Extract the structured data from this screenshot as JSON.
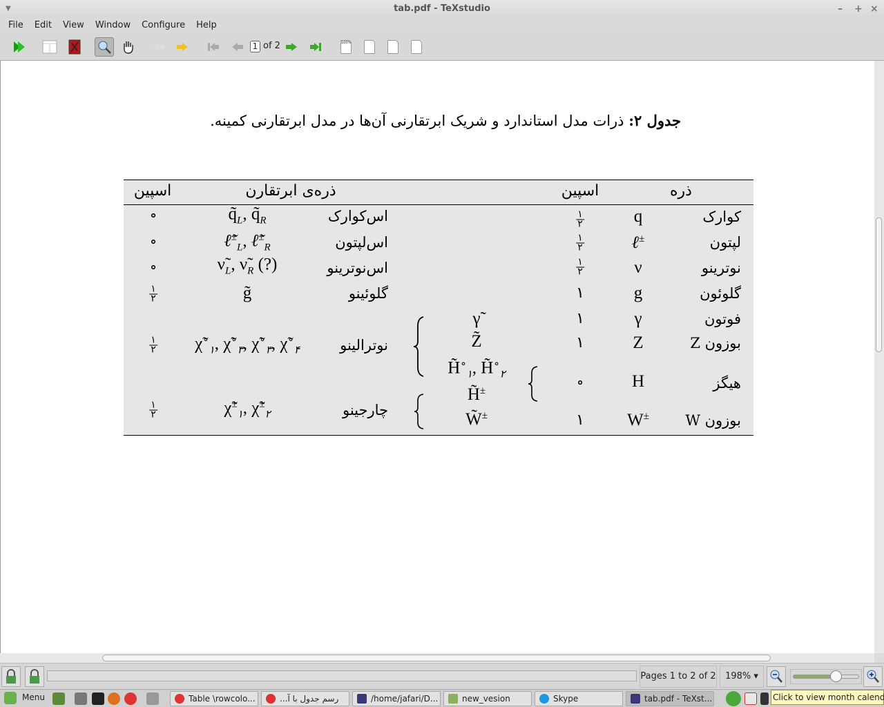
{
  "window": {
    "title": "tab.pdf - TeXstudio",
    "minimize": "–",
    "maximize": "+",
    "close": "×"
  },
  "menu": [
    "File",
    "Edit",
    "View",
    "Window",
    "Configure",
    "Help"
  ],
  "toolbar": {
    "page_current": "1",
    "page_of": "of 2",
    "icons": [
      "compile-run-icon",
      "grid-layout-icon",
      "pdf-book-icon",
      "magnifier-icon",
      "hand-pan-icon",
      "back-icon",
      "forward-icon",
      "first-page-icon",
      "prev-page-icon",
      "next-page-icon",
      "last-page-icon",
      "zoom-100-icon",
      "fit-width-icon",
      "fit-page-icon",
      "single-page-icon"
    ],
    "zoom_100": "100%"
  },
  "document": {
    "caption_label": "جدول ۲:",
    "caption_text": "ذرات مدل استاندارد و شریک ابرتقارنی آن‌ها در مدل ابرتقارنی کمینه.",
    "headers": {
      "particle": "ذره",
      "spin": "اسپین",
      "superpartner": "ذره‌ی ابرتقارن",
      "super_spin": "اسپین"
    },
    "sm": [
      {
        "name": "کوارک",
        "symbol": "q",
        "spin": {
          "num": "۱",
          "den": "۲"
        }
      },
      {
        "name": "لپتون",
        "symbol": "ℓ",
        "sup": "±",
        "spin": {
          "num": "۱",
          "den": "۲"
        }
      },
      {
        "name": "نوترینو",
        "symbol": "ν",
        "spin": {
          "num": "۱",
          "den": "۲"
        }
      },
      {
        "name": "گلوئون",
        "symbol": "g",
        "spin": "۱"
      },
      {
        "name": "فوتون",
        "symbol": "γ",
        "spin": "۱"
      },
      {
        "name": "بوزون Z",
        "symbol": "Z",
        "spin": "۱"
      },
      {
        "name": "هیگز",
        "symbol": "H",
        "spin": "∘"
      },
      {
        "name": "بوزون W",
        "symbol": "W",
        "sup": "±",
        "spin": "۱"
      }
    ],
    "susy": [
      {
        "name": "اس‌کوارک",
        "s1": "q̃",
        "sub1": "L",
        "s2": "q̃",
        "sub2": "R",
        "spin": "∘"
      },
      {
        "name": "اس‌لپتون",
        "s1": "ℓ̃",
        "sup1": "±",
        "sub1": "L",
        "s2": "ℓ̃",
        "sup2": "±",
        "sub2": "R",
        "spin": "∘"
      },
      {
        "name": "اس‌نوترینو",
        "s1": "ν̃",
        "sub1": "L",
        "s2": "ν̃",
        "sub2": "R",
        "extra": "(?)",
        "spin": "∘"
      },
      {
        "name": "گلوئینو",
        "s1": "g̃",
        "spin": {
          "num": "۱",
          "den": "۲"
        }
      },
      {
        "name": "نوترالینو",
        "symbols": [
          "χ̃",
          "χ̃",
          "χ̃",
          "χ̃"
        ],
        "subs": [
          "۱",
          "۳",
          "۳",
          "۴"
        ],
        "sup": "∘",
        "spin": {
          "num": "۱",
          "den": "۲"
        }
      },
      {
        "name": "چارجینو",
        "symbols": [
          "χ̃",
          "χ̃"
        ],
        "subs": [
          "۱",
          "۲"
        ],
        "sup": "±",
        "spin": {
          "num": "۱",
          "den": "۲"
        }
      }
    ],
    "gauginos": {
      "photino": "γ̃",
      "zino": "Z̃",
      "higgsino0": "H̃",
      "higgsino0_subs": [
        "۱",
        "۲"
      ],
      "higgsino0_sup": "∘",
      "higgsino_pm": "H̃",
      "wino": "W̃",
      "pm": "±"
    }
  },
  "statusbar": {
    "pages": "Pages 1 to 2 of 2",
    "zoom": "198%",
    "zoom_arrow": "▾",
    "zoom_slider_fraction": 0.64
  },
  "taskbar": {
    "menu": "Menu",
    "tasks": [
      "Table \\rowcolo...",
      "...رسم جدول با آ",
      "/home/jafari/D...",
      "new_vesion",
      "Skype",
      "tab.pdf - TeXst..."
    ],
    "tooltip": "Click to view month calendar"
  }
}
